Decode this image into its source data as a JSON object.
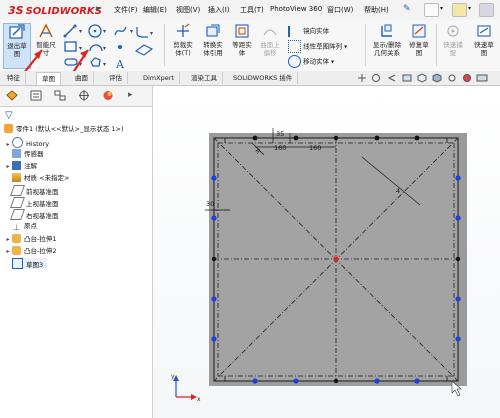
{
  "app": {
    "logo_text": "SOLIDWORKS",
    "logo_prefix": "3S"
  },
  "menu": [
    "文件(F)",
    "编辑(E)",
    "视图(V)",
    "插入(I)",
    "工具(T)",
    "PhotoView 360",
    "窗口(W)",
    "帮助(H)"
  ],
  "toolbar": {
    "exit_sketch": [
      "退出草",
      "图"
    ],
    "smart_dim": [
      "智能尺",
      "寸"
    ],
    "trim": [
      "剪裁实",
      "体(T)"
    ],
    "convert": [
      "转换实",
      "体引用"
    ],
    "offset": [
      "等距实",
      "体"
    ],
    "surface_offset": [
      "曲面上",
      "偏移"
    ],
    "mirror": "镜向实体",
    "linear_pattern": "线性草图阵列",
    "move": "移动实体",
    "show_delete": [
      "显示/删除",
      "几何关系"
    ],
    "repair": [
      "修复草",
      "图"
    ],
    "quick_snap": [
      "快速捕",
      "捉"
    ],
    "quick_view": [
      "快速草",
      "图"
    ]
  },
  "tabs": [
    "特征",
    "草图",
    "曲面",
    "评估",
    "DimXpert",
    "渲染工具",
    "SOLIDWORKS 插件"
  ],
  "active_tab": "草图",
  "tree": {
    "root": "零件1 (默认<<默认>_显示状态 1>)",
    "items": [
      "History",
      "传感器",
      "注解",
      "材质 <未指定>",
      "前视基准面",
      "上视基准面",
      "右视基准面",
      "原点",
      "凸台-拉伸1",
      "凸台-拉伸2",
      "草图3"
    ]
  },
  "dimensions": {
    "d1": "35",
    "d2": "160",
    "d3": "160",
    "d4": "4",
    "d5": "30"
  },
  "colors": {
    "accent": "#1f5fbf",
    "logo_red": "#cc1d1d",
    "arrow_red": "#e0231f",
    "point_blue": "#1b3fe0"
  }
}
